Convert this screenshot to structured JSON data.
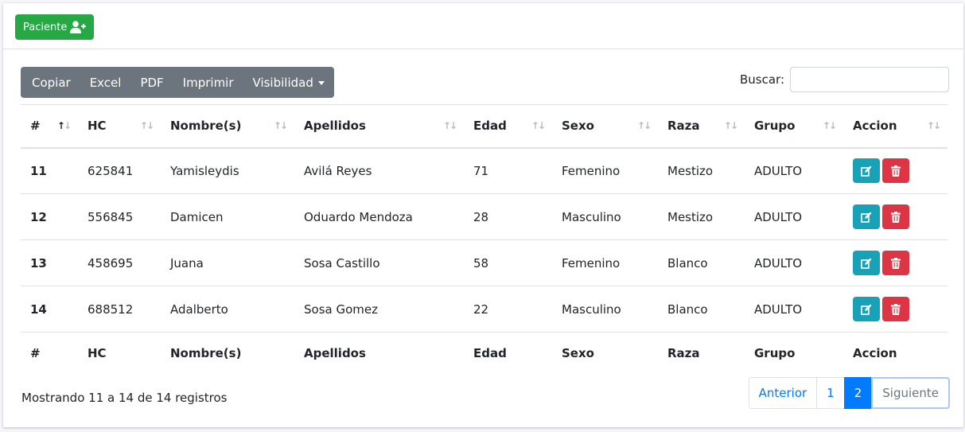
{
  "header": {
    "new_patient_label": "Paciente"
  },
  "toolbar": {
    "copy": "Copiar",
    "excel": "Excel",
    "pdf": "PDF",
    "print": "Imprimir",
    "visibility": "Visibilidad"
  },
  "search": {
    "label": "Buscar:",
    "value": "",
    "placeholder": ""
  },
  "table": {
    "columns": [
      "#",
      "HC",
      "Nombre(s)",
      "Apellidos",
      "Edad",
      "Sexo",
      "Raza",
      "Grupo",
      "Accion"
    ],
    "rows": [
      {
        "num": "11",
        "hc": "625841",
        "nombre": "Yamisleydis",
        "apellidos": "Avilá Reyes",
        "edad": "71",
        "sexo": "Femenino",
        "raza": "Mestizo",
        "grupo": "ADULTO"
      },
      {
        "num": "12",
        "hc": "556845",
        "nombre": "Damicen",
        "apellidos": "Oduardo Mendoza",
        "edad": "28",
        "sexo": "Masculino",
        "raza": "Mestizo",
        "grupo": "ADULTO"
      },
      {
        "num": "13",
        "hc": "458695",
        "nombre": "Juana",
        "apellidos": "Sosa Castillo",
        "edad": "58",
        "sexo": "Femenino",
        "raza": "Blanco",
        "grupo": "ADULTO"
      },
      {
        "num": "14",
        "hc": "688512",
        "nombre": "Adalberto",
        "apellidos": "Sosa Gomez",
        "edad": "22",
        "sexo": "Masculino",
        "raza": "Blanco",
        "grupo": "ADULTO"
      }
    ]
  },
  "footer": {
    "info": "Mostrando 11 a 14 de 14 registros",
    "pagination": {
      "prev": "Anterior",
      "page1": "1",
      "page2": "2",
      "next": "Siguiente",
      "current": "2"
    }
  },
  "colors": {
    "success": "#28a745",
    "secondary": "#6c757d",
    "info": "#17a2b8",
    "danger": "#dc3545",
    "primary": "#007bff"
  },
  "icons": {
    "new_patient": "user-plus-icon",
    "edit": "edit-icon",
    "delete": "trash-icon",
    "sort": "sort-arrows-icon"
  }
}
